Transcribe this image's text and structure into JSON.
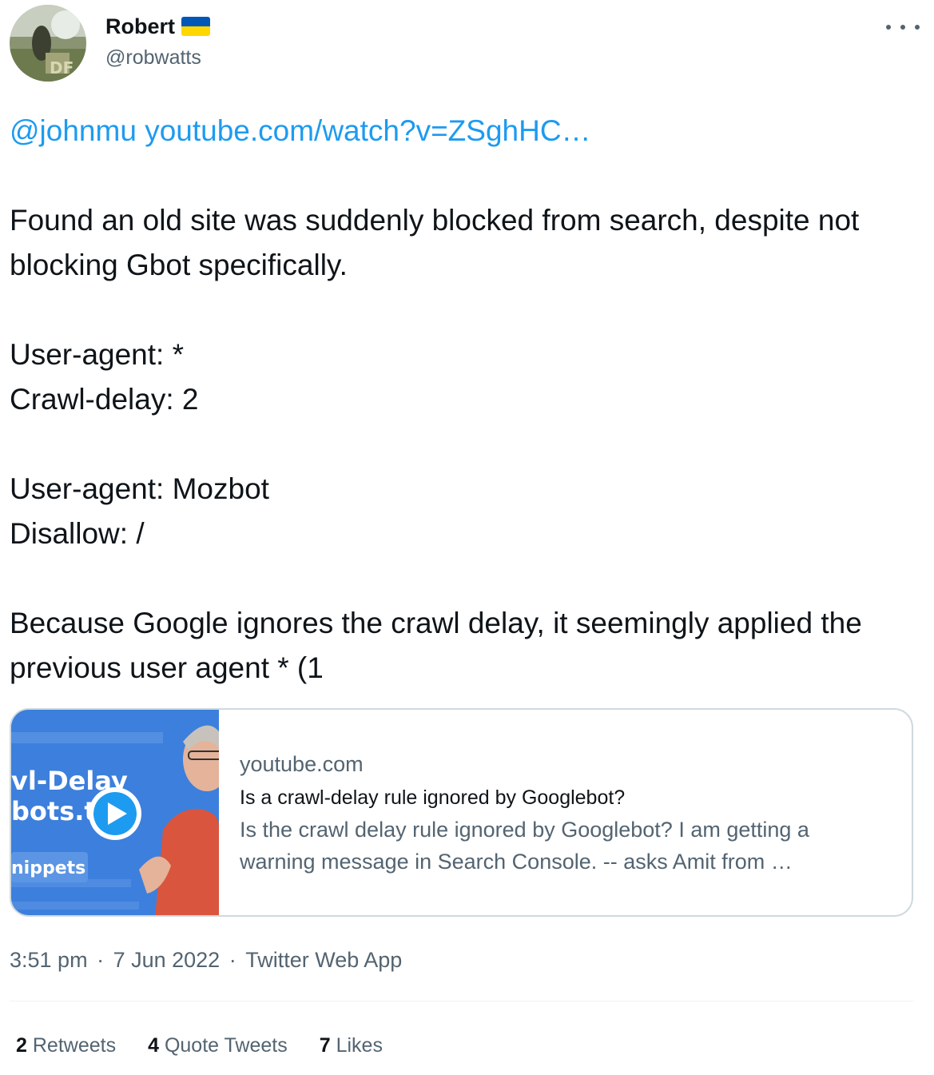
{
  "author": {
    "name": "Robert",
    "handle": "@robwatts",
    "flag_icon": "ukraine-flag-icon"
  },
  "tweet": {
    "mention": "@johnmu",
    "link": "youtube.com/watch?v=ZSghHC…",
    "paragraphs": [
      "Found an old site was suddenly blocked from search, despite not blocking Gbot specifically.",
      "User-agent: *\nCrawl-delay: 2",
      "User-agent: Mozbot\nDisallow: /",
      "Because Google ignores the crawl delay, it seemingly applied the previous user agent * (1"
    ]
  },
  "card": {
    "domain": "youtube.com",
    "title": "Is a crawl-delay rule ignored by Googlebot?",
    "description": "Is the crawl delay rule ignored by Googlebot? I am getting a warning message in Search Console. -- asks Amit from …",
    "thumbnail_text": [
      "vl-Delay",
      "bots.t",
      "nippets"
    ]
  },
  "meta": {
    "time": "3:51 pm",
    "date": "7 Jun 2022",
    "source": "Twitter Web App"
  },
  "stats": [
    {
      "count": "2",
      "label": "Retweets"
    },
    {
      "count": "4",
      "label": "Quote Tweets"
    },
    {
      "count": "7",
      "label": "Likes"
    }
  ],
  "colors": {
    "link": "#1d9bf0",
    "secondary_text": "#536471",
    "border": "#cfd9de"
  }
}
